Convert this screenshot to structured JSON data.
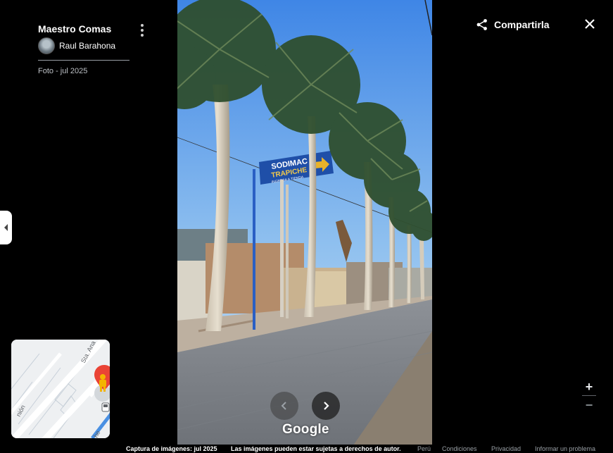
{
  "place": {
    "title": "Maestro Comas"
  },
  "author": {
    "name": "Raul Barahona"
  },
  "photo": {
    "date_label": "Foto - jul 2025"
  },
  "sign": {
    "brand": "SODIMAC",
    "location": "TRAPICHE",
    "subtitle": "INGRESA A TIENDA"
  },
  "minimap": {
    "street_1": "Sta. Ana",
    "street_2": "nión",
    "street_3": "he"
  },
  "share": {
    "label": "Compartirla",
    "icon": "share-icon"
  },
  "close": {
    "icon": "close-icon"
  },
  "zoom": {
    "in_label": "+",
    "out_label": "−"
  },
  "navigation": {
    "prev_icon": "chevron-left-icon",
    "next_icon": "chevron-right-icon"
  },
  "branding": {
    "logo": "Google"
  },
  "footer": {
    "capture": "Captura de imágenes: jul 2025",
    "copyright": "Las imágenes pueden estar sujetas a derechos de autor.",
    "country": "Perú",
    "terms": "Condiciones",
    "privacy": "Privacidad",
    "report": "Informar un problema"
  },
  "colors": {
    "background": "#000000",
    "sign_blue": "#1f4fa8",
    "arrow_yellow": "#e8b22a",
    "pin_red": "#ea4335",
    "pegman_yellow": "#f4b400"
  }
}
